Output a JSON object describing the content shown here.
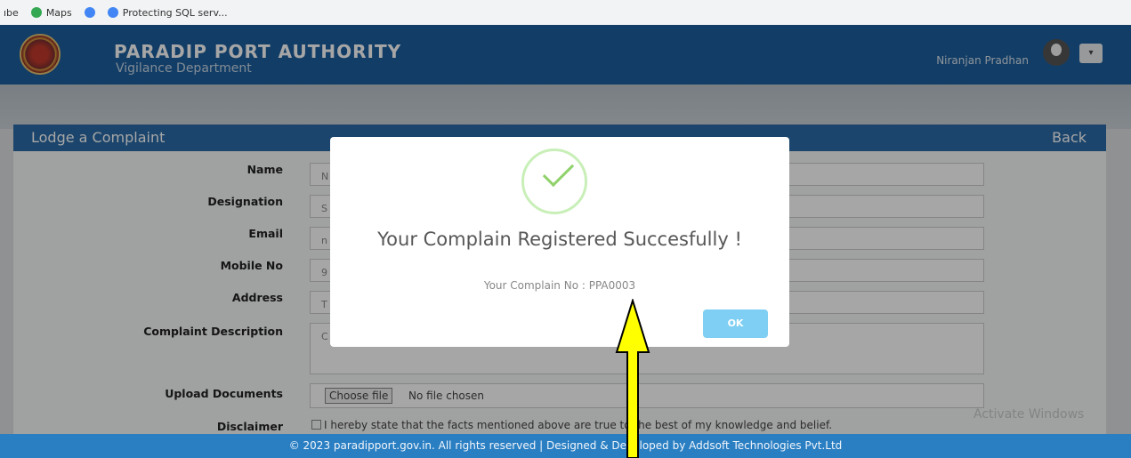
{
  "bookmarks": [
    "ıbe",
    "Maps",
    "Protecting SQL serv..."
  ],
  "header": {
    "org": "PARADIP PORT AUTHORITY",
    "dept": "Vigilance Department",
    "user": "Niranjan Pradhan",
    "dropdown_icon": "▾"
  },
  "panel": {
    "title": "Lodge a Complaint",
    "back": "Back"
  },
  "form": {
    "fields": [
      {
        "label": "Name",
        "value": "N"
      },
      {
        "label": "Designation",
        "value": "S"
      },
      {
        "label": "Email",
        "value": "n"
      },
      {
        "label": "Mobile No",
        "value": "9"
      },
      {
        "label": "Address",
        "value": "T"
      },
      {
        "label": "Complaint Description",
        "value": "C"
      }
    ],
    "upload_label": "Upload Documents",
    "choose_file": "Choose file",
    "no_file": "No file chosen",
    "disclaimer_label": "Disclaimer",
    "disclaimer_text": "I hereby state that the facts mentioned above are true to the best of my knowledge and belief."
  },
  "watermark": "Activate Windows",
  "footer": "© 2023 paradipport.gov.in. All rights reserved | Designed & Developed by Addsoft Technologies Pvt.Ltd",
  "modal": {
    "title": "Your Complain Registered Succesfully !",
    "text": "Your Complain No : PPA0003",
    "ok": "OK"
  },
  "colors": {
    "header": "#1d5f9d",
    "footer": "#2a7fc3",
    "ok": "#7ecff3",
    "arrow": "#ffff00"
  }
}
